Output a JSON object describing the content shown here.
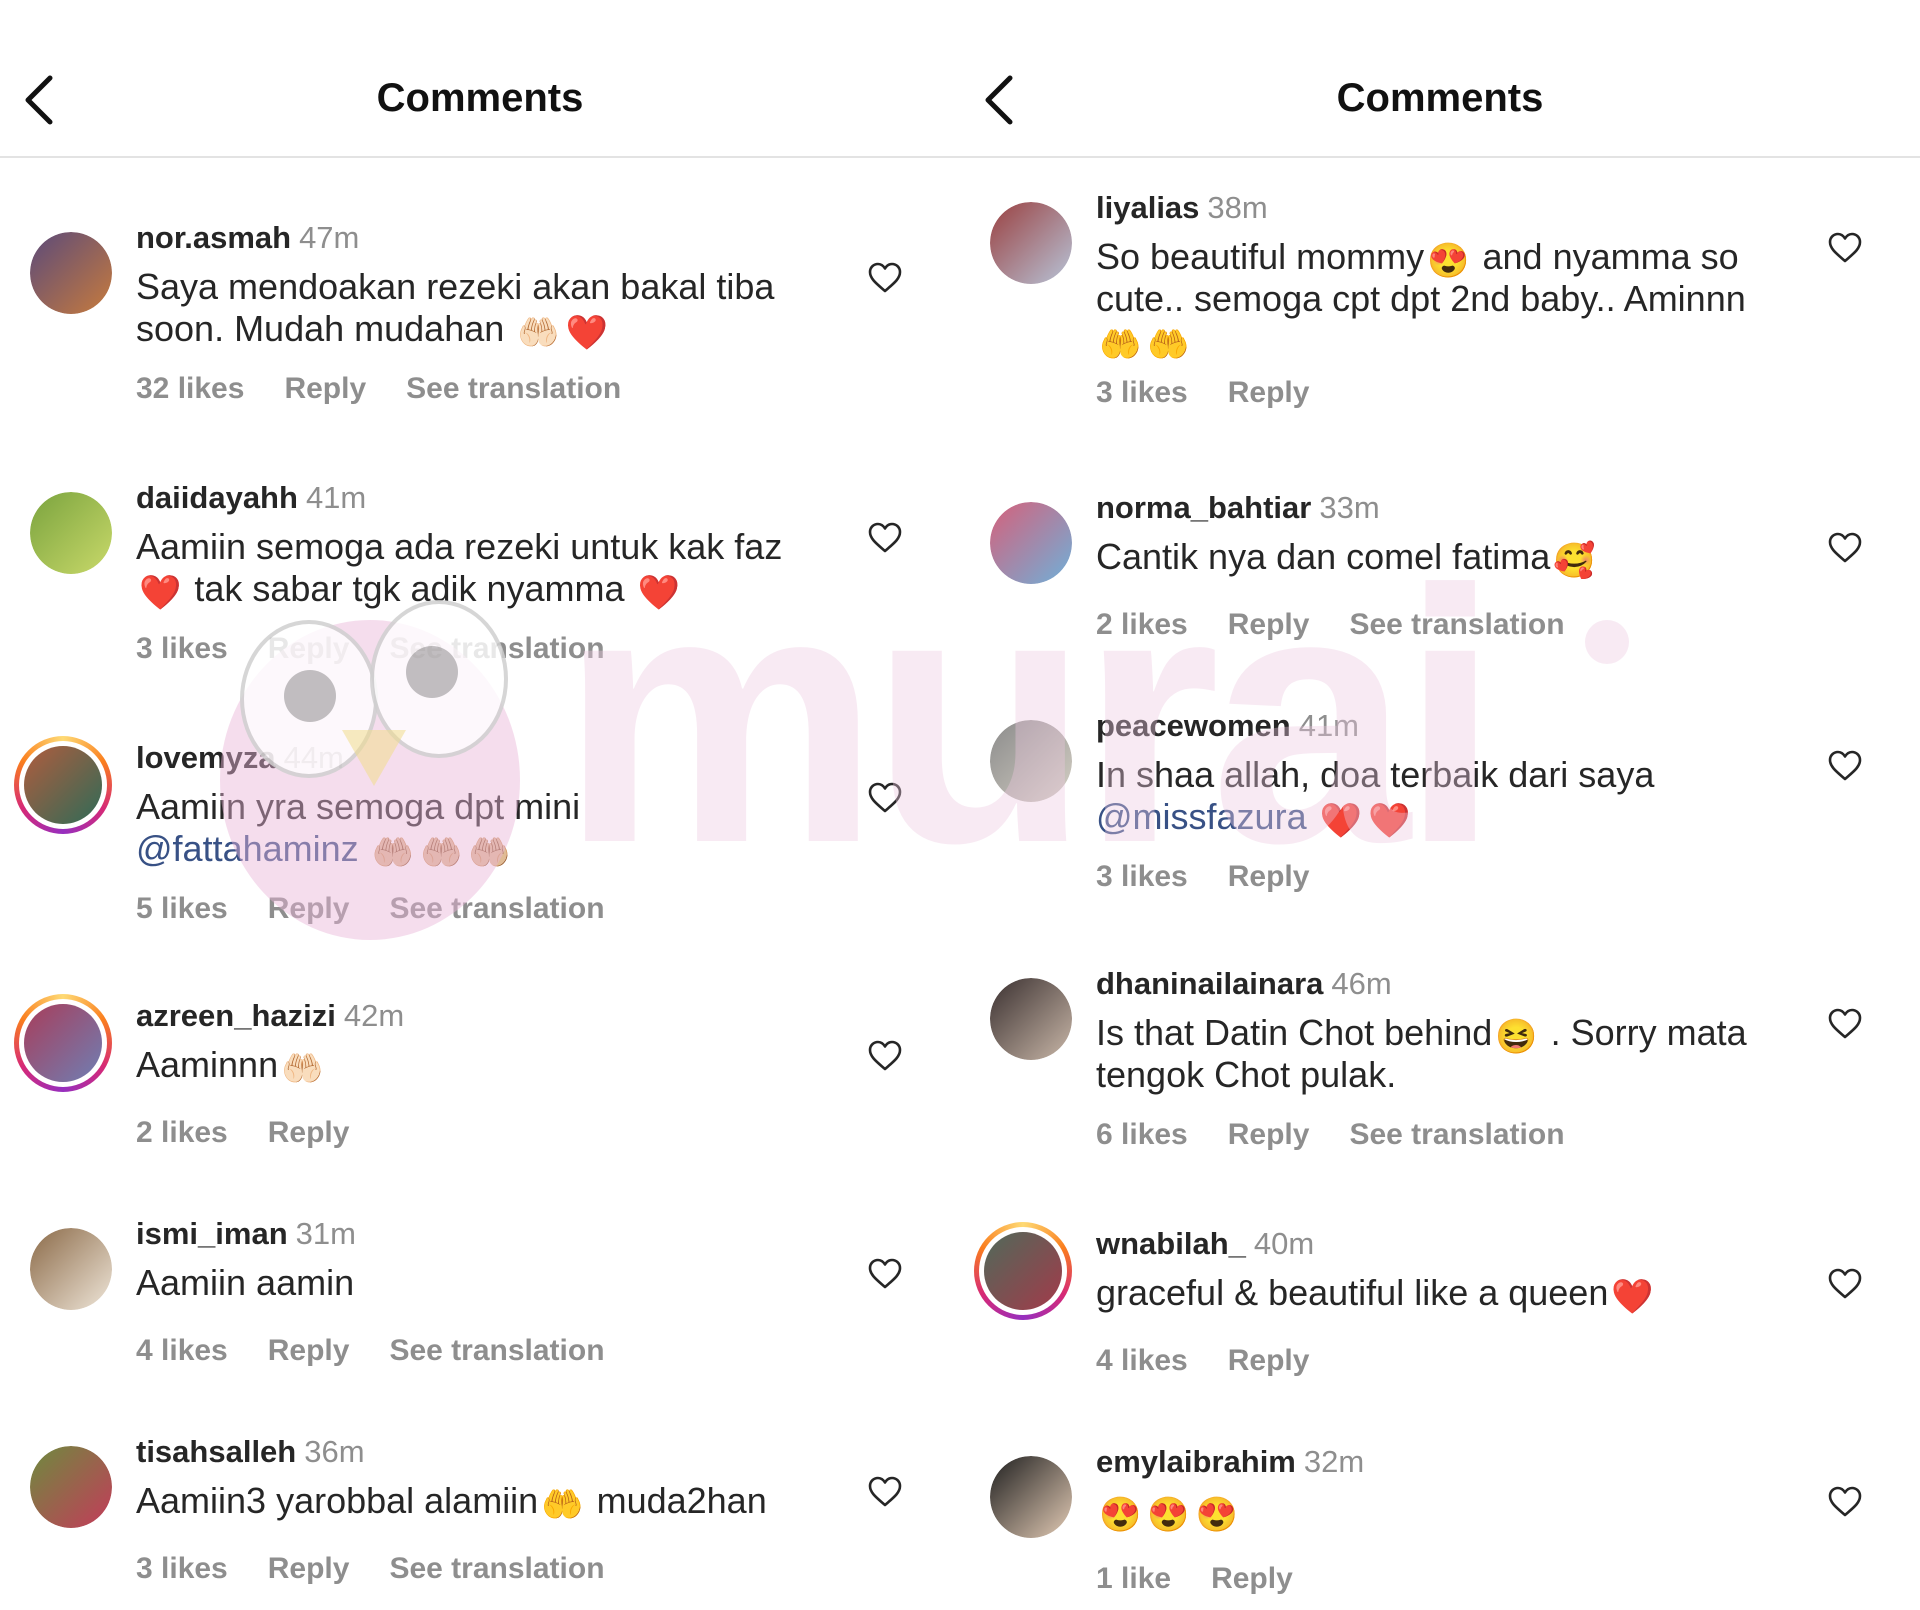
{
  "header": {
    "title": "Comments"
  },
  "left": [
    {
      "username": "nor.asmah",
      "time": "47m",
      "line1": "Saya mendoakan rezeki akan bakal tiba",
      "line2": "soon. Mudah mudahan",
      "emojis2": [
        "🤲🏻",
        "❤️"
      ],
      "likes": "32 likes",
      "reply": "Reply",
      "translate": "See translation",
      "colors": [
        "#5b4a7a",
        "#c77b3d"
      ]
    },
    {
      "username": "daiidayahh",
      "time": "41m",
      "line1": "Aamiin semoga ada rezeki untuk kak faz",
      "line2": "tak sabar tgk adik nyamma",
      "emojis2pre": [
        "❤️"
      ],
      "emojis2": [
        "❤️"
      ],
      "likes": "3 likes",
      "reply": "Reply",
      "translate": "See translation",
      "colors": [
        "#7aa33e",
        "#c9d96a"
      ]
    },
    {
      "username": "lovemyza",
      "time": "44m",
      "line1": "Aamiin yra semoga dpt mini",
      "mention": "@fattahaminz",
      "emojis2": [
        "🤲🏼",
        "🤲🏼",
        "🤲🏼"
      ],
      "likes": "5 likes",
      "reply": "Reply",
      "translate": "See translation",
      "colors": [
        "#b05c3e",
        "#2f6b57"
      ]
    },
    {
      "username": "azreen_hazizi",
      "time": "42m",
      "line1": "Aaminnn",
      "emojis1": [
        "🤲🏻"
      ],
      "likes": "2 likes",
      "reply": "Reply",
      "colors": [
        "#a83d5a",
        "#6f7fb4"
      ]
    },
    {
      "username": "ismi_iman",
      "time": "31m",
      "line1": "Aamiin aamin",
      "likes": "4 likes",
      "reply": "Reply",
      "translate": "See translation",
      "colors": [
        "#8b6a48",
        "#efe6d9"
      ]
    },
    {
      "username": "tisahsalleh",
      "time": "36m",
      "line1": "Aamiin3 yarobbal alamiin",
      "emojis1": [
        "🤲"
      ],
      "line1b": "muda2han",
      "likes": "3 likes",
      "reply": "Reply",
      "translate": "See translation",
      "colors": [
        "#6d8b3e",
        "#c43b5a"
      ]
    }
  ],
  "right": [
    {
      "username": "liyalias",
      "time": "38m",
      "line1": "So beautiful mommy",
      "emojis1": [
        "😍"
      ],
      "line1b": "and nyamma so",
      "line2": "cute.. semoga cpt dpt 2nd baby.. Aminnn",
      "line3emojis": [
        "🤲",
        "🤲"
      ],
      "likes": "3 likes",
      "reply": "Reply",
      "colors": [
        "#9a4040",
        "#b7c4d8"
      ]
    },
    {
      "username": "norma_bahtiar",
      "time": "33m",
      "line1": "Cantik nya dan comel fatima",
      "emojis1": [
        "🥰"
      ],
      "likes": "2 likes",
      "reply": "Reply",
      "translate": "See translation",
      "colors": [
        "#d6607a",
        "#6fb0d9"
      ]
    },
    {
      "username": "peacewomen",
      "time": "41m",
      "line1": "In shaa allah, doa terbaik dari saya",
      "mention": "@missfazura",
      "emojis2": [
        "❤️",
        "❤️"
      ],
      "likes": "3 likes",
      "reply": "Reply",
      "colors": [
        "#8b8b8b",
        "#d4cfc4"
      ]
    },
    {
      "username": "dhaninailainara",
      "time": "46m",
      "line1": "Is that Datin Chot behind",
      "emojis1": [
        "😆"
      ],
      "line1b": ". Sorry mata",
      "line2": "tengok Chot pulak.",
      "likes": "6 likes",
      "reply": "Reply",
      "translate": "See translation",
      "colors": [
        "#3a3030",
        "#c9b7a8"
      ]
    },
    {
      "username": "wnabilah_",
      "time": "40m",
      "line1": "graceful & beautiful like a queen",
      "emojis1": [
        "❤️"
      ],
      "likes": "4 likes",
      "reply": "Reply",
      "colors": [
        "#4f6a5a",
        "#a33a4a"
      ]
    },
    {
      "username": "emylaibrahim",
      "time": "32m",
      "line1": "",
      "emojis1": [
        "😍",
        "😍",
        "😍"
      ],
      "likes": "1 like",
      "reply": "Reply",
      "colors": [
        "#1f1f1f",
        "#e3cbb5"
      ]
    }
  ],
  "watermark": {
    "brand": "murai"
  }
}
